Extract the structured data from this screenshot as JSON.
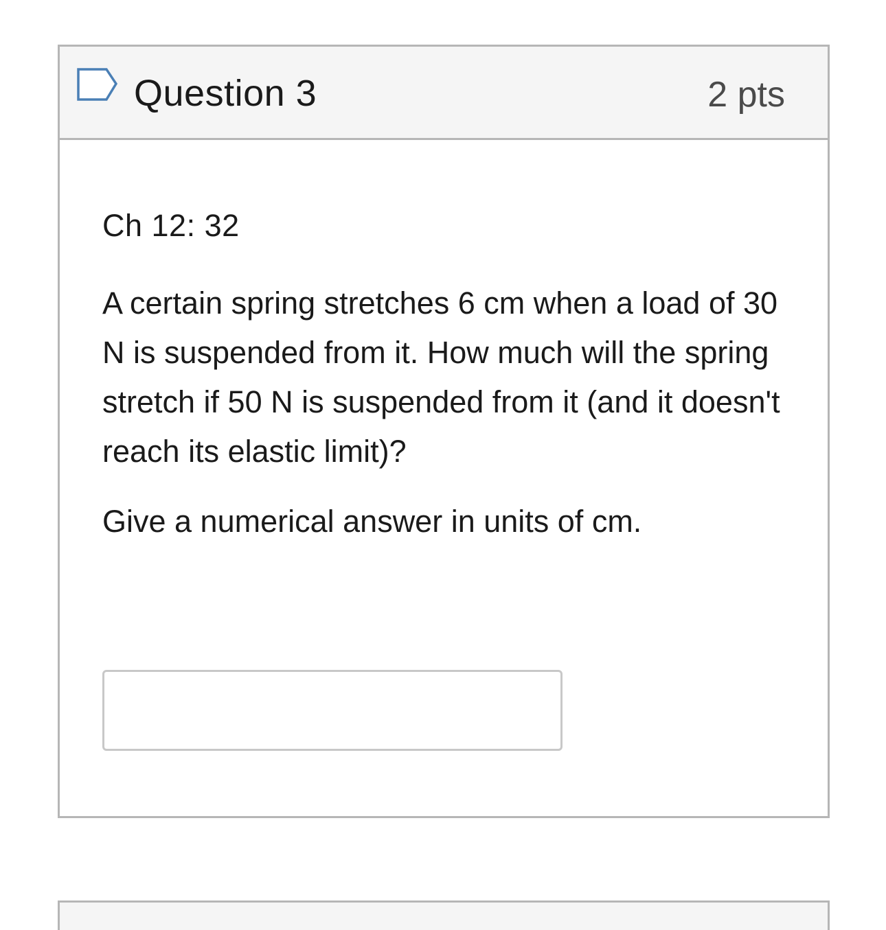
{
  "question": {
    "title": "Question 3",
    "points": "2 pts",
    "flag_icon": "flag-outline-icon",
    "reference": "Ch 12: 32",
    "text": "A certain spring stretches 6 cm when a load of 30 N is suspended from it. How much will the spring stretch if 50 N is suspended from it (and it doesn't reach its elastic limit)?",
    "instruction": "Give a numerical answer in units of cm.",
    "answer": {
      "value": "",
      "placeholder": ""
    }
  },
  "colors": {
    "header_background": "#f5f5f5",
    "border": "#b6b6b6",
    "flag_outline": "#4a7fb5"
  }
}
